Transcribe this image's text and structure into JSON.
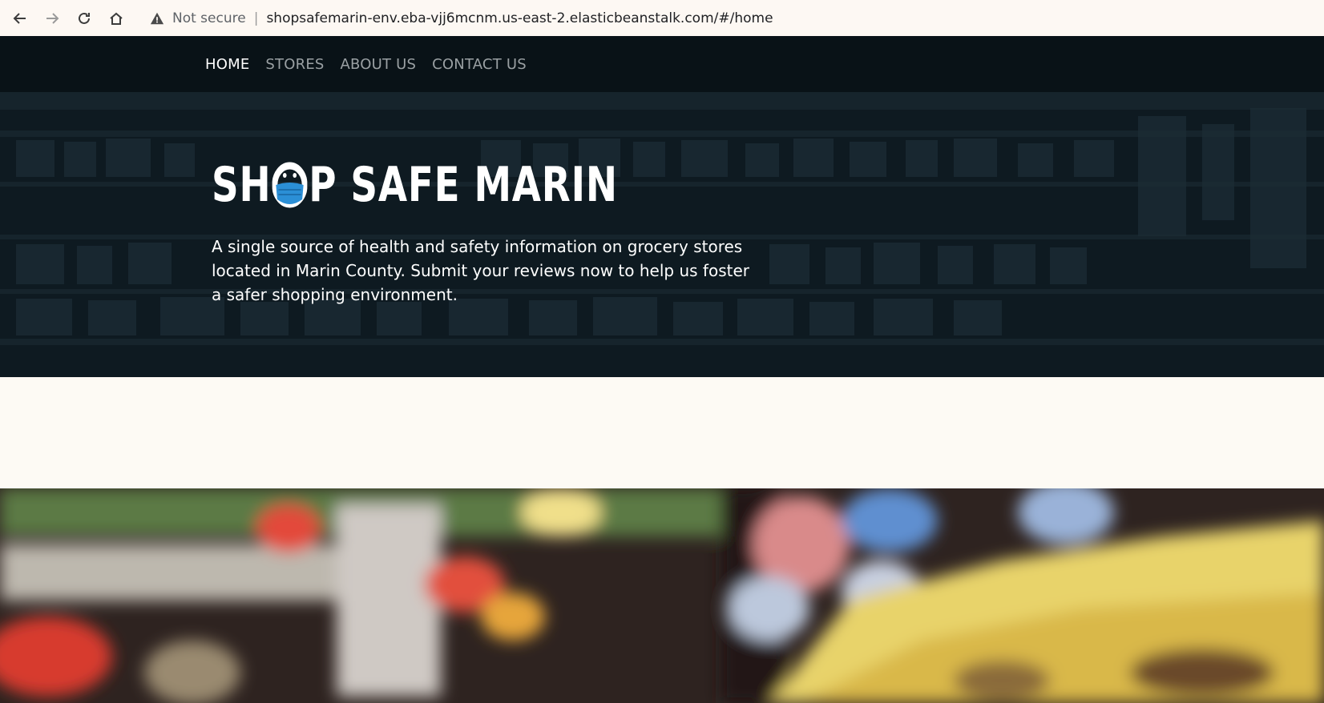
{
  "browser": {
    "security_label": "Not secure",
    "separator": "|",
    "url": "shopsafemarin-env.eba-vjj6mcnm.us-east-2.elasticbeanstalk.com/#/home",
    "icons": [
      "back-icon",
      "forward-icon",
      "reload-icon",
      "home-icon",
      "warning-icon"
    ]
  },
  "nav": {
    "items": [
      {
        "label": "HOME",
        "active": true
      },
      {
        "label": "STORES",
        "active": false
      },
      {
        "label": "ABOUT US",
        "active": false
      },
      {
        "label": "CONTACT US",
        "active": false
      }
    ]
  },
  "hero": {
    "brand_part1": "SH",
    "brand_part2": "P SAFE MARIN",
    "tagline": "A single source of health and safety information on grocery stores located in Marin County. Submit your reviews now to help us foster a safer shopping environment."
  },
  "colors": {
    "nav_bg": "#091217",
    "hero_bg": "#0f1b22",
    "mask_blue": "#2b8fd6",
    "page_bg": "#fdfaf4"
  }
}
